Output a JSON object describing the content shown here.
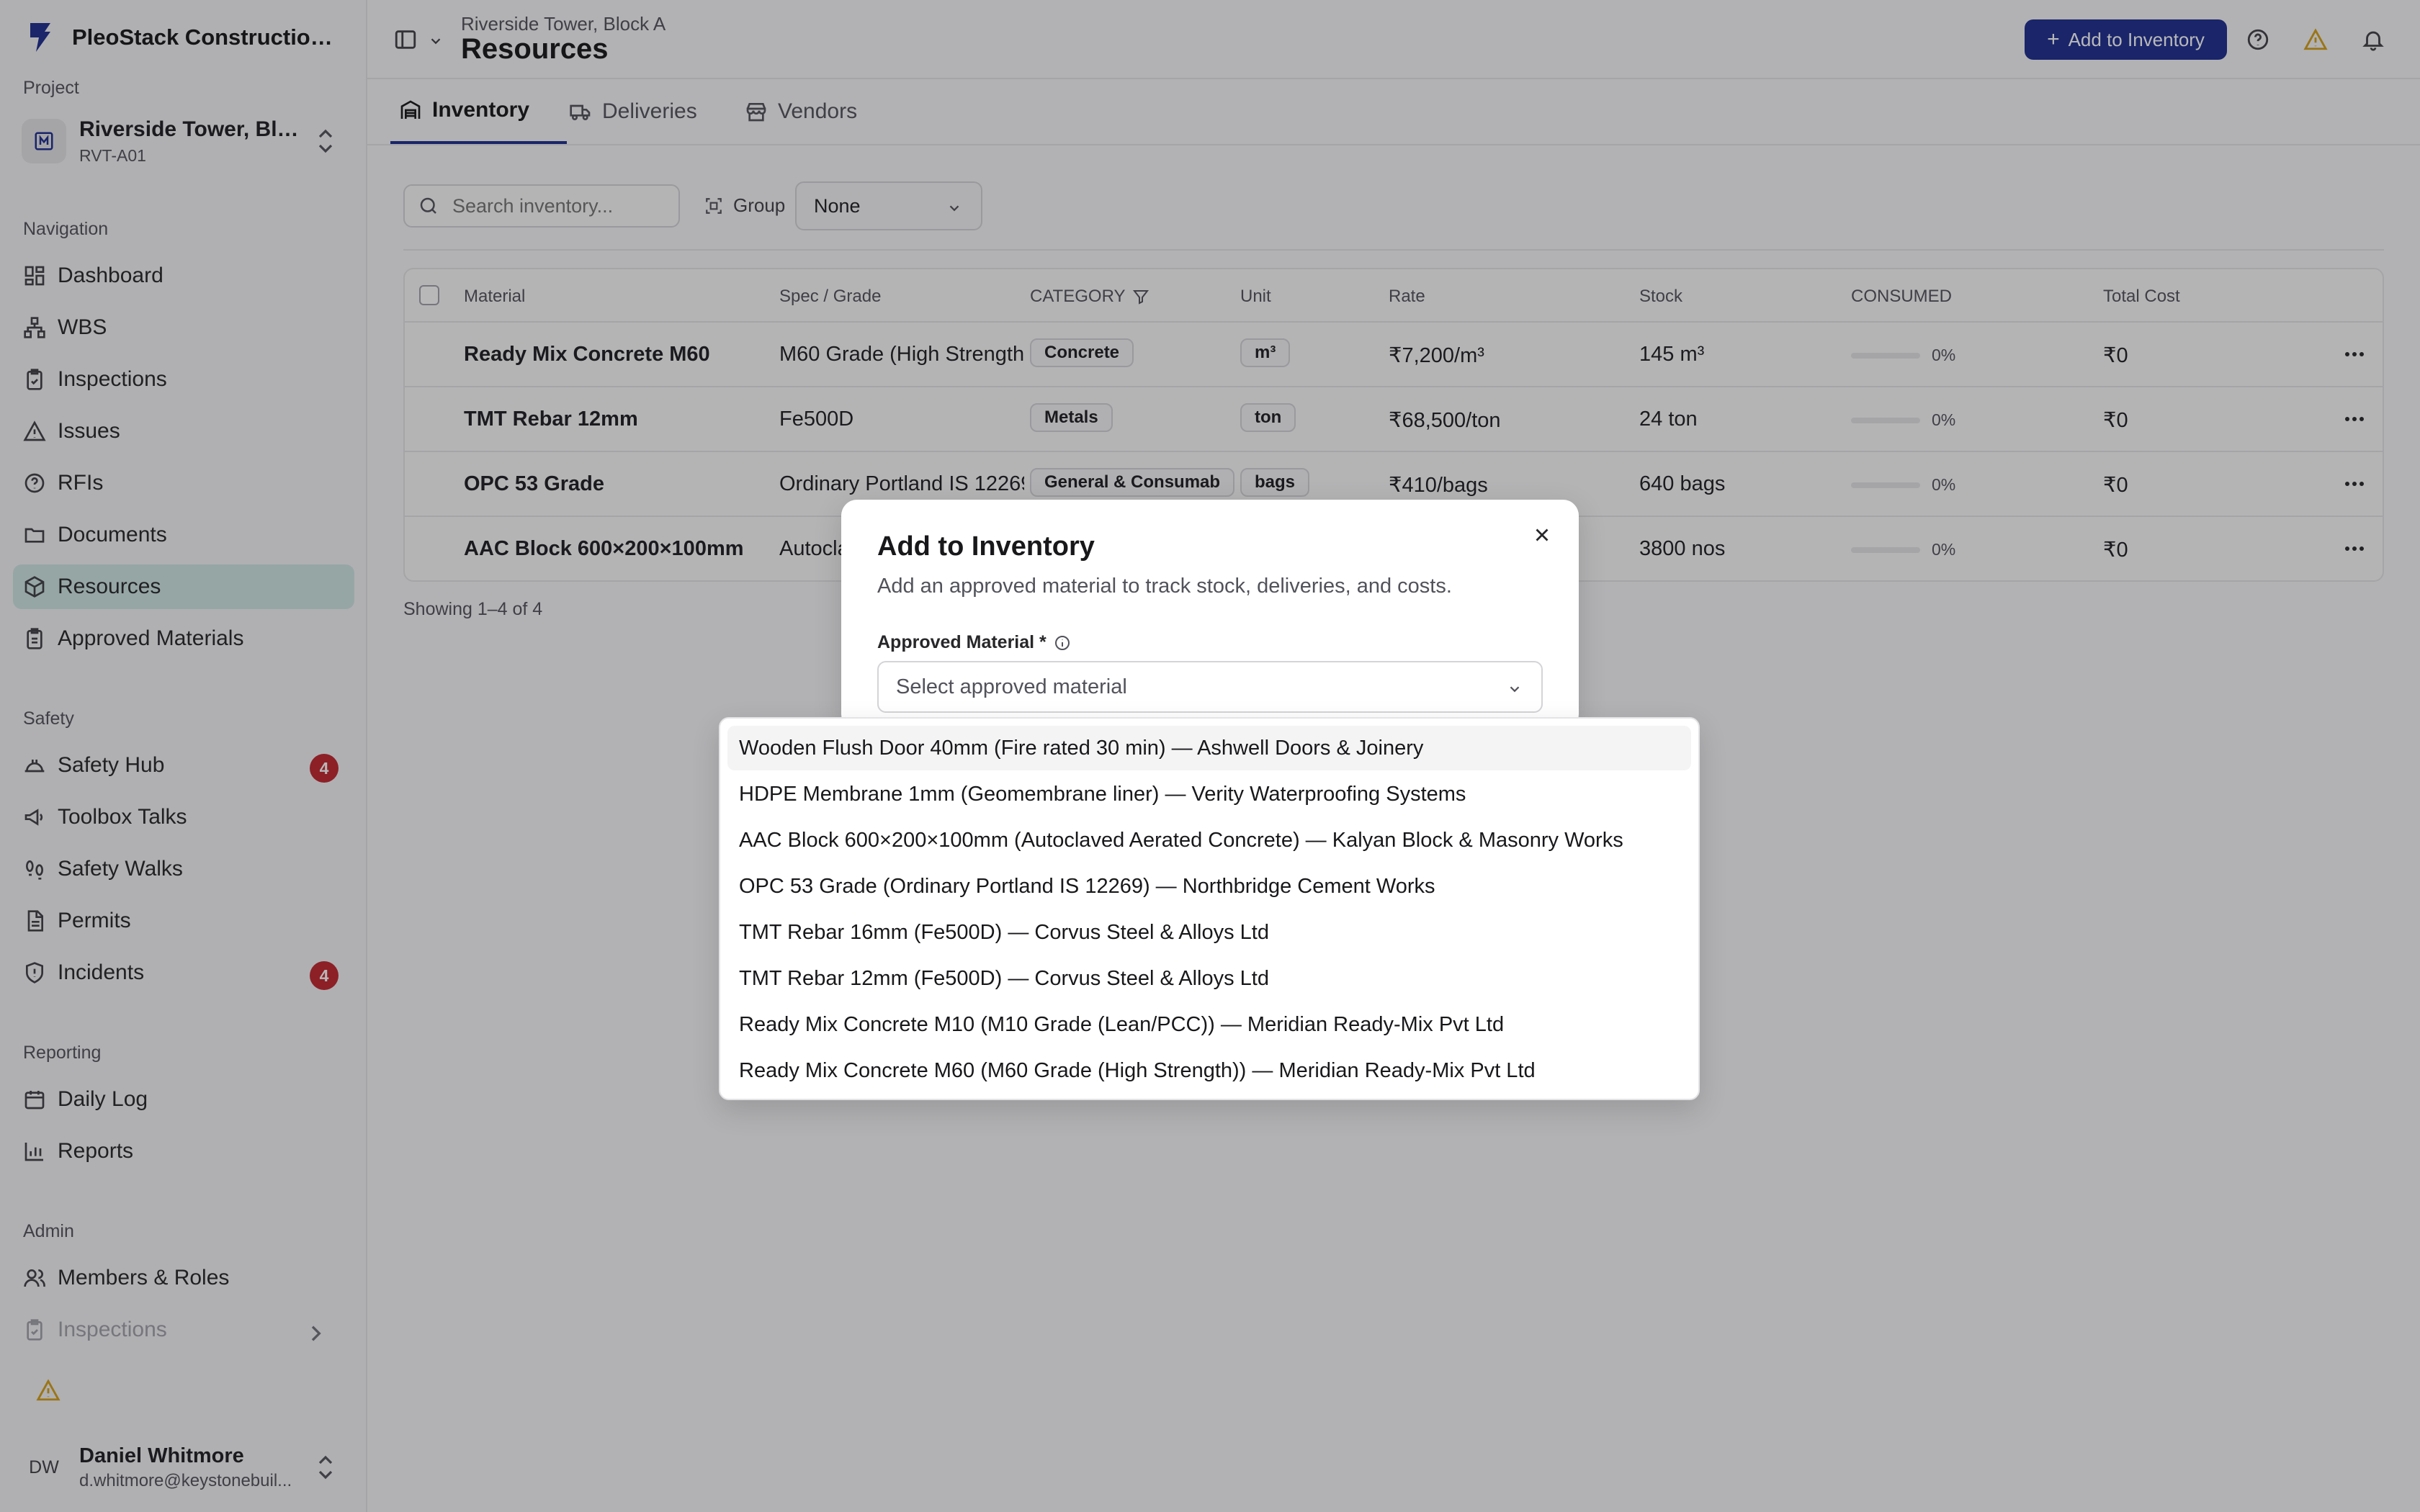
{
  "app": {
    "name": "PleoStack Construction ..."
  },
  "sidebar": {
    "project_label": "Project",
    "project": {
      "name": "Riverside Tower, Bloc...",
      "code": "RVT-A01"
    },
    "sections": {
      "navigation": "Navigation",
      "safety": "Safety",
      "reporting": "Reporting",
      "admin": "Admin"
    },
    "nav": [
      {
        "label": "Dashboard",
        "icon": "dashboard-icon"
      },
      {
        "label": "WBS",
        "icon": "wbs-icon"
      },
      {
        "label": "Inspections",
        "icon": "clipboard-check-icon"
      },
      {
        "label": "Issues",
        "icon": "warning-triangle-icon"
      },
      {
        "label": "RFIs",
        "icon": "help-circle-icon"
      },
      {
        "label": "Documents",
        "icon": "folder-icon"
      },
      {
        "label": "Resources",
        "icon": "package-icon",
        "active": true
      },
      {
        "label": "Approved Materials",
        "icon": "clipboard-icon"
      }
    ],
    "safety": [
      {
        "label": "Safety Hub",
        "icon": "hard-hat-icon",
        "badge": "4"
      },
      {
        "label": "Toolbox Talks",
        "icon": "megaphone-icon"
      },
      {
        "label": "Safety Walks",
        "icon": "footprints-icon"
      },
      {
        "label": "Permits",
        "icon": "document-icon"
      },
      {
        "label": "Incidents",
        "icon": "shield-alert-icon",
        "badge": "4"
      }
    ],
    "reporting": [
      {
        "label": "Daily Log",
        "icon": "calendar-icon"
      },
      {
        "label": "Reports",
        "icon": "bar-chart-icon"
      }
    ],
    "admin": [
      {
        "label": "Members & Roles",
        "icon": "users-icon"
      },
      {
        "label": "Inspections",
        "icon": "clipboard-check-icon"
      }
    ],
    "user": {
      "initials": "DW",
      "name": "Daniel Whitmore",
      "email": "d.whitmore@keystonebuil..."
    }
  },
  "header": {
    "breadcrumb": "Riverside Tower, Block A",
    "title": "Resources",
    "add_button": "Add to Inventory"
  },
  "tabs": [
    {
      "label": "Inventory",
      "active": true
    },
    {
      "label": "Deliveries"
    },
    {
      "label": "Vendors"
    }
  ],
  "toolbar": {
    "search_placeholder": "Search inventory...",
    "group_label": "Group",
    "group_value": "None"
  },
  "table": {
    "columns": [
      "Material",
      "Spec / Grade",
      "CATEGORY",
      "Unit",
      "Rate",
      "Stock",
      "CONSUMED",
      "Total Cost"
    ],
    "rows": [
      {
        "material": "Ready Mix Concrete M60",
        "spec": "M60 Grade (High Strength)",
        "category": "Concrete",
        "unit": "m³",
        "rate": "₹7,200/m³",
        "stock": "145 m³",
        "consumed_pct": 0,
        "consumed": "0%",
        "total": "₹0"
      },
      {
        "material": "TMT Rebar 12mm",
        "spec": "Fe500D",
        "category": "Metals",
        "unit": "ton",
        "rate": "₹68,500/ton",
        "stock": "24 ton",
        "consumed_pct": 0,
        "consumed": "0%",
        "total": "₹0"
      },
      {
        "material": "OPC 53 Grade",
        "spec": "Ordinary Portland IS 12269",
        "category": "General & Consumab",
        "unit": "bags",
        "rate": "₹410/bags",
        "stock": "640 bags",
        "consumed_pct": 0,
        "consumed": "0%",
        "total": "₹0"
      },
      {
        "material": "AAC Block 600×200×100mm",
        "spec": "Autoclaved Aerated Concrete",
        "category": "",
        "unit": "",
        "rate": "",
        "stock": "3800 nos",
        "consumed_pct": 0,
        "consumed": "0%",
        "total": "₹0"
      }
    ],
    "footer": "Showing 1–4 of 4"
  },
  "modal": {
    "title": "Add to Inventory",
    "description": "Add an approved material to track stock, deliveries, and costs.",
    "field_label": "Approved Material *",
    "select_placeholder": "Select approved material"
  },
  "dropdown": {
    "options": [
      "Wooden Flush Door 40mm (Fire rated 30 min) — Ashwell Doors & Joinery",
      "HDPE Membrane 1mm (Geomembrane liner) — Verity Waterproofing Systems",
      "AAC Block 600×200×100mm (Autoclaved Aerated Concrete) — Kalyan Block & Masonry Works",
      "OPC 53 Grade (Ordinary Portland IS 12269) — Northbridge Cement Works",
      "TMT Rebar 16mm (Fe500D) — Corvus Steel & Alloys Ltd",
      "TMT Rebar 12mm (Fe500D) — Corvus Steel & Alloys Ltd",
      "Ready Mix Concrete M10 (M10 Grade (Lean/PCC)) — Meridian Ready-Mix Pvt Ltd",
      "Ready Mix Concrete M60 (M60 Grade (High Strength)) — Meridian Ready-Mix Pvt Ltd"
    ],
    "highlighted_index": 0
  },
  "colors": {
    "accent": "#1e2d8f",
    "active_nav": "#cfe5e2",
    "badge": "#c0262d",
    "warning": "#d4a017"
  }
}
